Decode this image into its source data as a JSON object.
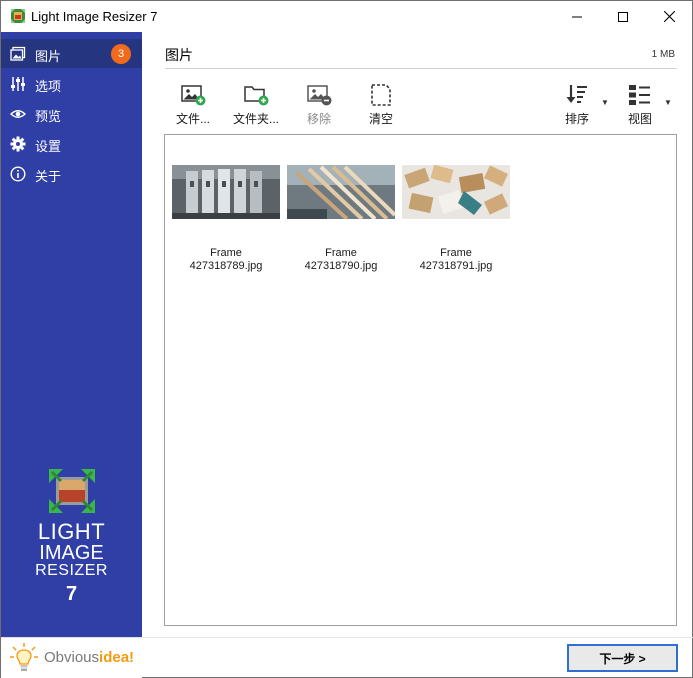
{
  "window": {
    "title": "Light Image Resizer 7"
  },
  "sidebar": {
    "items": [
      {
        "label": "图片",
        "icon": "images-icon",
        "badge": "3",
        "active": true
      },
      {
        "label": "选项",
        "icon": "sliders-icon"
      },
      {
        "label": "预览",
        "icon": "eye-icon"
      },
      {
        "label": "设置",
        "icon": "gear-icon"
      },
      {
        "label": "关于",
        "icon": "info-icon"
      }
    ],
    "brand": {
      "line1": "LIGHT",
      "line2": "IMAGE",
      "line3": "RESIZER",
      "line4": "7"
    },
    "obviousidea": {
      "part1": "Obvious",
      "part2": "idea!"
    }
  },
  "main": {
    "title": "图片",
    "size": "1 MB",
    "toolbar": {
      "add_files": "文件...",
      "add_folder": "文件夹...",
      "remove": "移除",
      "clear": "清空",
      "sort": "排序",
      "view": "视图"
    },
    "files": [
      {
        "line1": "Frame",
        "line2": "427318789.jpg"
      },
      {
        "line1": "Frame",
        "line2": "427318790.jpg"
      },
      {
        "line1": "Frame",
        "line2": "427318791.jpg"
      }
    ]
  },
  "footer": {
    "next": "下一步 >"
  },
  "colors": {
    "sidebar": "#2f3fa6",
    "sidebar_active": "#26357f",
    "badge": "#f26a1b",
    "accent": "#f39c12",
    "button_border": "#2f6fcf"
  }
}
